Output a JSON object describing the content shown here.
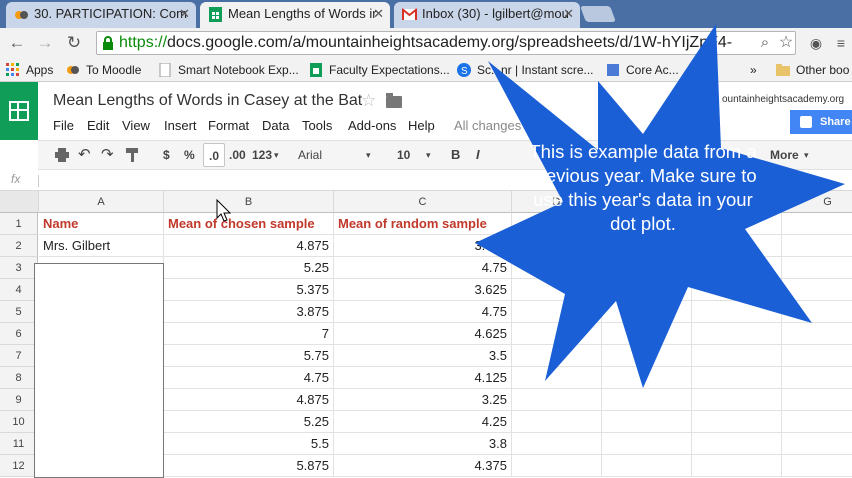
{
  "browser": {
    "tabs": [
      {
        "title": "30. PARTICIPATION: Com",
        "active": false,
        "icon": "moodle-icon"
      },
      {
        "title": "Mean Lengths of Words ir",
        "active": true,
        "icon": "sheets-icon"
      },
      {
        "title": "Inbox (30) - lgilbert@mou",
        "active": false,
        "icon": "gmail-icon"
      }
    ],
    "url_scheme": "https://",
    "url_rest": "docs.google.com/a/mountainheightsacademy.org/spreadsheets/d/1W-hYIjZ",
    "url_tail": "pF4-",
    "bookmarks": [
      "Apps",
      "To Moodle",
      "Smart Notebook Exp...",
      "Faculty Expectations...",
      "Sc...nr | Instant scre...",
      "Core Ac...",
      "Other boo"
    ],
    "bookmarks_more": "»"
  },
  "sheet": {
    "title": "Mean Lengths of Words in Casey at the Bat",
    "menu": [
      "File",
      "Edit",
      "View",
      "Insert",
      "Format",
      "Data",
      "Tools",
      "Add-ons",
      "Help"
    ],
    "save_status": "All changes",
    "account": "ountainheightsacademy.org",
    "share_label": "Share",
    "toolbar": {
      "currency": "$",
      "percent": "%",
      "dec_less": ".0",
      "dec_more": ".00",
      "number_format": "123",
      "font": "Arial",
      "font_size": "10",
      "bold": "B",
      "italic": "I",
      "more": "More"
    },
    "fx_label": "fx",
    "columns": [
      "A",
      "B",
      "C",
      "D",
      "E",
      "F",
      "G"
    ],
    "rows": [
      "1",
      "2",
      "3",
      "4",
      "5",
      "6",
      "7",
      "8",
      "9",
      "10",
      "11",
      "12"
    ],
    "headers": [
      "Name",
      "Mean of chosen sample",
      "Mean of random sample"
    ],
    "name_row2": "Mrs. Gilbert",
    "col_b": [
      "4.875",
      "5.25",
      "5.375",
      "3.875",
      "7",
      "5.75",
      "4.75",
      "4.875",
      "5.25",
      "5.5",
      "5.875"
    ],
    "col_c": [
      "3.875",
      "4.75",
      "3.625",
      "4.75",
      "4.625",
      "3.5",
      "4.125",
      "3.25",
      "4.25",
      "3.8",
      "4.375"
    ]
  },
  "callout": {
    "text": "This is example data from a previous year. Make sure to use this year's data in your dot plot.",
    "color": "#1a5fd6"
  }
}
